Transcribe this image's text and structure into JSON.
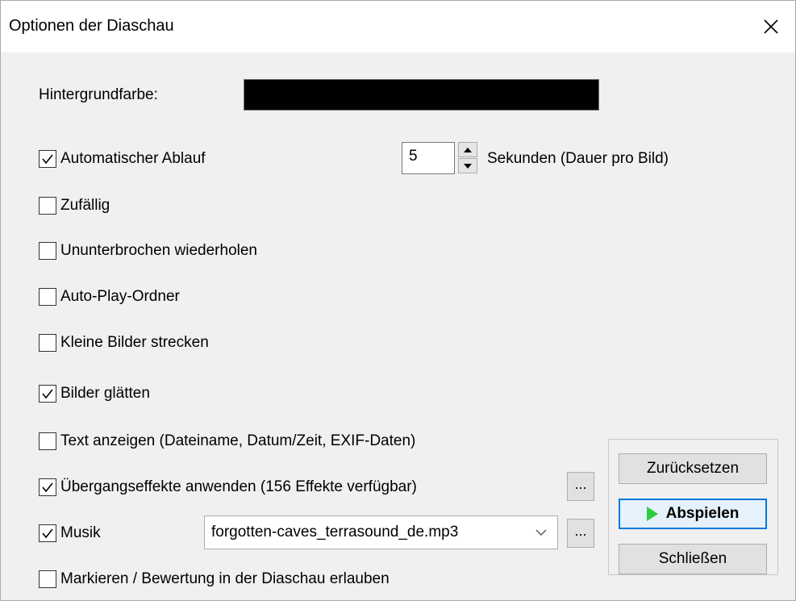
{
  "window": {
    "title": "Optionen der Diaschau",
    "close_glyph": "✕"
  },
  "background": {
    "label": "Hintergrundfarbe:",
    "color": "#000000"
  },
  "auto_advance": {
    "label": "Automatischer Ablauf",
    "checked": true,
    "seconds_value": "5",
    "seconds_label": "Sekunden (Dauer pro Bild)"
  },
  "options": [
    {
      "label": "Zufällig",
      "checked": false
    },
    {
      "label": "Ununterbrochen wiederholen",
      "checked": false
    },
    {
      "label": "Auto-Play-Ordner",
      "checked": false
    },
    {
      "label": "Kleine Bilder strecken",
      "checked": false
    },
    {
      "label": "Bilder glätten",
      "checked": true
    },
    {
      "label": "Text anzeigen (Dateiname, Datum/Zeit, EXIF-Daten)",
      "checked": false
    },
    {
      "label": "Übergangseffekte anwenden (156 Effekte verfügbar)",
      "checked": true
    },
    {
      "label": "Musik",
      "checked": true
    },
    {
      "label": "Markieren / Bewertung in der Diaschau erlauben",
      "checked": false
    }
  ],
  "effects_more_label": "...",
  "music": {
    "file": "forgotten-caves_terrasound_de.mp3",
    "more_label": "..."
  },
  "buttons": {
    "reset": "Zurücksetzen",
    "play": "Abspielen",
    "close": "Schließen"
  },
  "colors": {
    "accent": "#0078d7",
    "play_icon": "#2ecc40"
  }
}
